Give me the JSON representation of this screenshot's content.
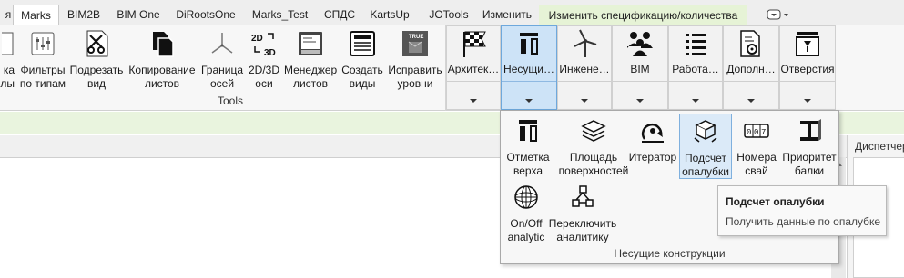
{
  "tabs": [
    {
      "label": "я",
      "active": false
    },
    {
      "label": "Marks",
      "active": true
    },
    {
      "label": "BIM2B",
      "active": false
    },
    {
      "label": "BIM One",
      "active": false
    },
    {
      "label": "DiRootsOne",
      "active": false
    },
    {
      "label": "Marks_Test",
      "active": false
    },
    {
      "label": "СПДС",
      "active": false
    },
    {
      "label": "KartsUp",
      "active": false
    },
    {
      "label": "JOTools",
      "active": false
    },
    {
      "label": "Изменить",
      "active": false
    },
    {
      "label": "Изменить спецификацию/количества",
      "active": false
    }
  ],
  "tools_panel": {
    "title": "Tools",
    "items": [
      {
        "label": "ка\nлы",
        "icon": "partial-tool-icon"
      },
      {
        "label": "Фильтры\nпо типам",
        "icon": "filter-icon"
      },
      {
        "label": "Подрезать\nвид",
        "icon": "scissors-icon"
      },
      {
        "label": "Копирование\nлистов",
        "icon": "copy-sheets-icon"
      },
      {
        "label": "Граница\nосей",
        "icon": "axes-icon"
      },
      {
        "label": "2D/3D\nоси",
        "icon": "2d-3d-icon"
      },
      {
        "label": "Менеджер\nлистов",
        "icon": "sheet-manager-icon"
      },
      {
        "label": "Создать\nвиды",
        "icon": "create-views-icon"
      },
      {
        "label": "Исправить\nуровни",
        "icon": "fix-levels-icon"
      }
    ]
  },
  "split_buttons": [
    {
      "label": "Архитек…",
      "icon": "checkered-flag-icon"
    },
    {
      "label": "Несущи…",
      "icon": "structural-marker-icon"
    },
    {
      "label": "Инжене…",
      "icon": "wind-turbine-icon"
    },
    {
      "label": "BIM",
      "icon": "people-icon"
    },
    {
      "label": "Работа…",
      "icon": "list-icon"
    },
    {
      "label": "Дополн…",
      "icon": "document-gear-icon"
    },
    {
      "label": "Отверстия",
      "icon": "opening-icon"
    }
  ],
  "dropdown": {
    "footer": "Несущие конструкции",
    "items": [
      {
        "label": "Отметка\nверха",
        "icon": "top-elevation-icon"
      },
      {
        "label": "Площадь\nповерхностей",
        "icon": "layers-icon"
      },
      {
        "label": "Итератор",
        "icon": "iterator-icon"
      },
      {
        "label": "Подсчет\nопалубки",
        "icon": "formwork-box-icon"
      },
      {
        "label": "Номера\nсвай",
        "icon": "counter-icon"
      },
      {
        "label": "Приоритет\nбалки",
        "icon": "beam-icon"
      },
      {
        "label": "On/Off\nanalytic",
        "icon": "sphere-mesh-icon"
      },
      {
        "label": "Переключить\nаналитику",
        "icon": "cubes-network-icon"
      }
    ]
  },
  "tooltip": {
    "title": "Подсчет опалубки",
    "description": "Получить данные по опалубке"
  },
  "side_panel": {
    "title": "Диспетчер"
  }
}
